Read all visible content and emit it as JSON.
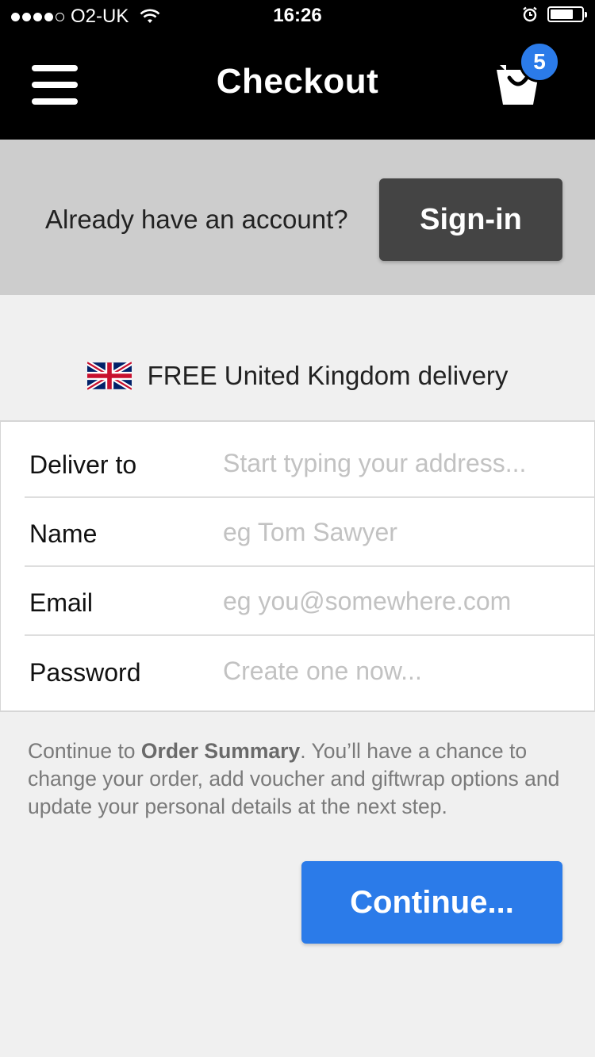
{
  "status_bar": {
    "carrier": "O2-UK",
    "time": "16:26",
    "battery_level": 0.75
  },
  "header": {
    "title": "Checkout",
    "cart_count": "5"
  },
  "signin": {
    "prompt": "Already have an account?",
    "button_label": "Sign-in"
  },
  "delivery": {
    "text": "FREE United Kingdom delivery",
    "flag_icon": "uk-flag-icon"
  },
  "form": {
    "deliver_to": {
      "label": "Deliver to",
      "placeholder": "Start typing your address...",
      "value": ""
    },
    "name": {
      "label": "Name",
      "placeholder": "eg Tom Sawyer",
      "value": ""
    },
    "email": {
      "label": "Email",
      "placeholder": "eg you@somewhere.com",
      "value": ""
    },
    "password": {
      "label": "Password",
      "placeholder": "Create one now...",
      "value": ""
    }
  },
  "info": {
    "prefix": "Continue to ",
    "bold": "Order Summary",
    "suffix": ". You’ll have a chance to change your order, add voucher and giftwrap options and update your personal details at the next step."
  },
  "continue_label": "Continue...",
  "colors": {
    "accent": "#2b7be9",
    "header_bg": "#000000",
    "signin_band_bg": "#cdcdcd",
    "signin_button_bg": "#444444",
    "page_bg": "#f0f0f0"
  }
}
